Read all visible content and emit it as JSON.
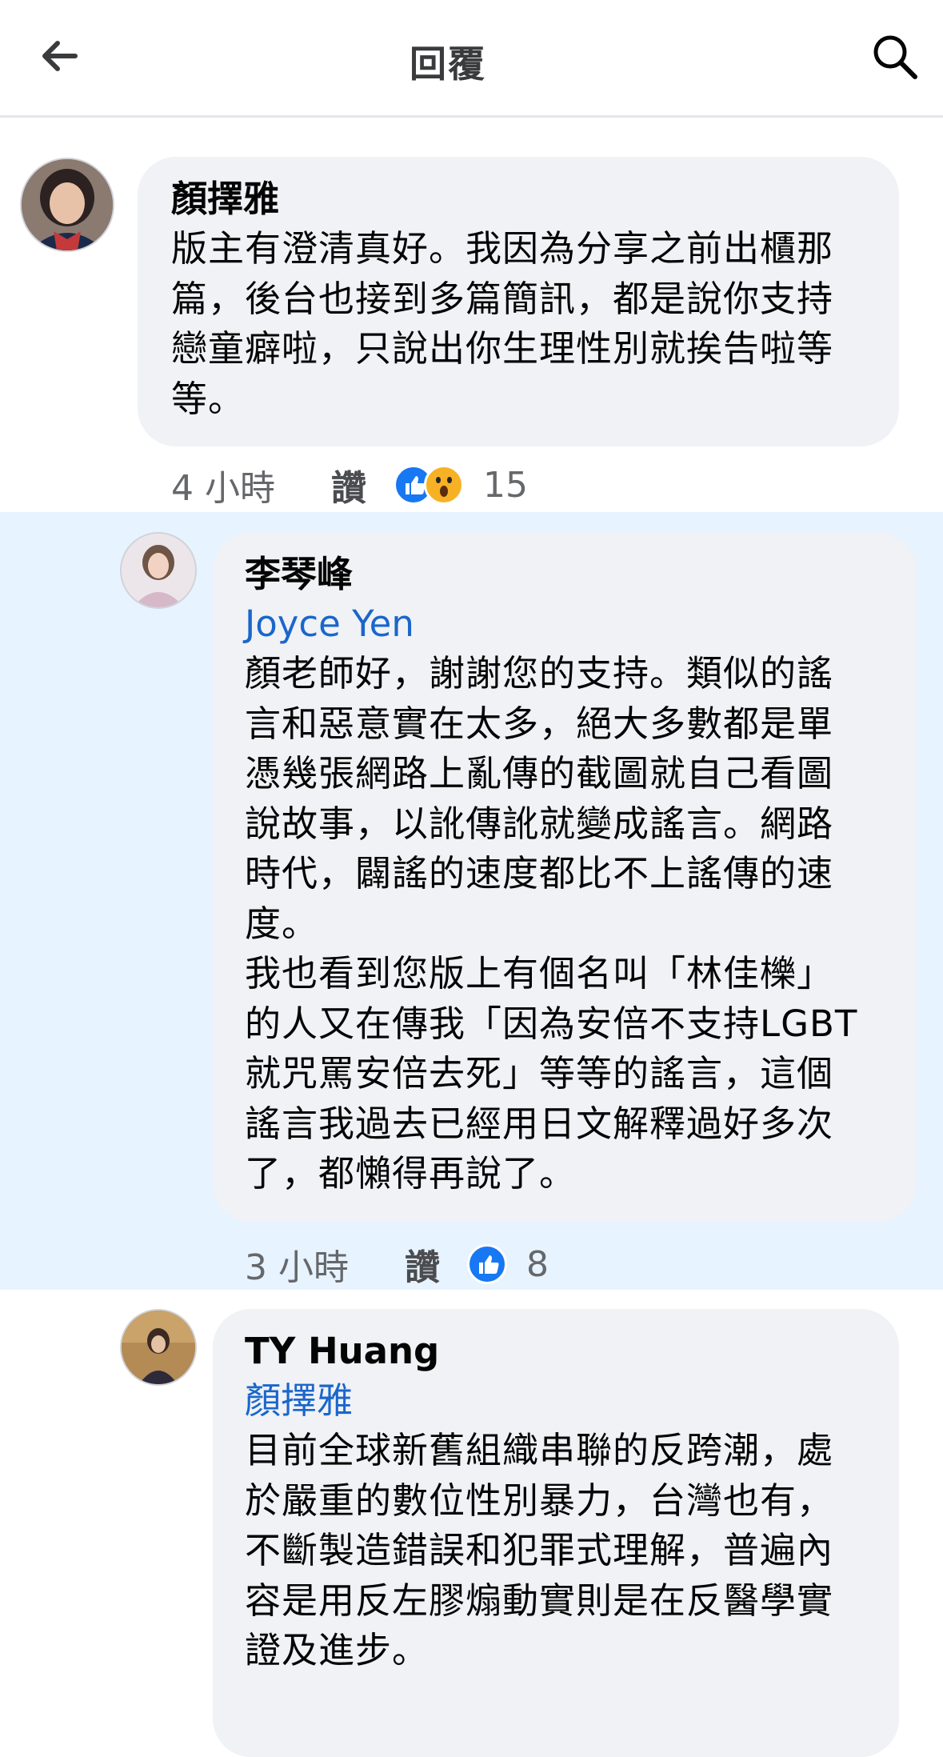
{
  "header": {
    "title": "回覆",
    "back_icon": "back-arrow-icon",
    "search_icon": "search-icon"
  },
  "comments": [
    {
      "author": "顏擇雅",
      "text": "版主有澄清真好。我因為分享之前出櫃那\n篇，後台也接到多篇簡訊，都是說你支持\n戀童癖啦，只說出你生理性別就挨告啦等\n等。",
      "time": "4 小時",
      "like_label": "讚",
      "reactions": [
        "like-reaction-icon",
        "wow-reaction-icon"
      ],
      "reaction_count": "15"
    },
    {
      "author": "李琴峰",
      "mention": "Joyce Yen",
      "text": "顏老師好，謝謝您的支持。類似的謠\n言和惡意實在太多，絕大多數都是單\n憑幾張網路上亂傳的截圖就自己看圖\n說故事，以訛傳訛就變成謠言。網路\n時代，闢謠的速度都比不上謠傳的速\n度。\n我也看到您版上有個名叫「林佳櫟」\n的人又在傳我「因為安倍不支持LGBT\n就咒罵安倍去死」等等的謠言，這個\n謠言我過去已經用日文解釋過好多次\n了，都懶得再說了。",
      "time": "3 小時",
      "like_label": "讚",
      "reactions": [
        "like-reaction-icon"
      ],
      "reaction_count": "8"
    },
    {
      "author": "TY Huang",
      "mention": "顏擇雅",
      "text": "目前全球新舊組織串聯的反跨潮，處\n於嚴重的數位性別暴力，台灣也有，\n不斷製造錯誤和犯罪式理解，普遍內\n容是用反左膠煽動實則是在反醫學實\n證及進步。"
    }
  ],
  "colors": {
    "highlight": "#e7f3ff",
    "bubble": "#f0f2f5",
    "mention": "#1a66cc",
    "like_blue": "#1877f2",
    "wow_yellow": "#f7b125"
  }
}
